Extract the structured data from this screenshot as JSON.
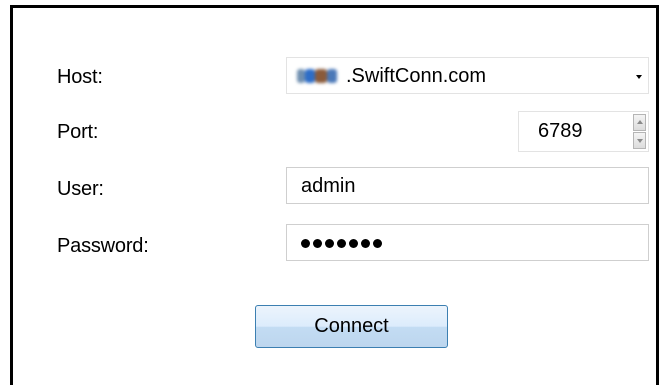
{
  "form": {
    "host_label": "Host:",
    "host_value": ".SwiftConn.com",
    "port_label": "Port:",
    "port_value": "6789",
    "user_label": "User:",
    "user_value": "admin",
    "password_label": "Password:",
    "password_mask": "•••••••"
  },
  "actions": {
    "connect_label": "Connect"
  },
  "icons": {
    "host_dropdown": "chevron-down-icon",
    "port_increment": "spin-up-icon",
    "port_decrement": "spin-down-icon"
  },
  "colors": {
    "button_border": "#3c7fb1",
    "button_fill_top": "#ecf4fc",
    "button_fill_bottom": "#bdd6ee",
    "field_border": "#cfcfcf"
  }
}
